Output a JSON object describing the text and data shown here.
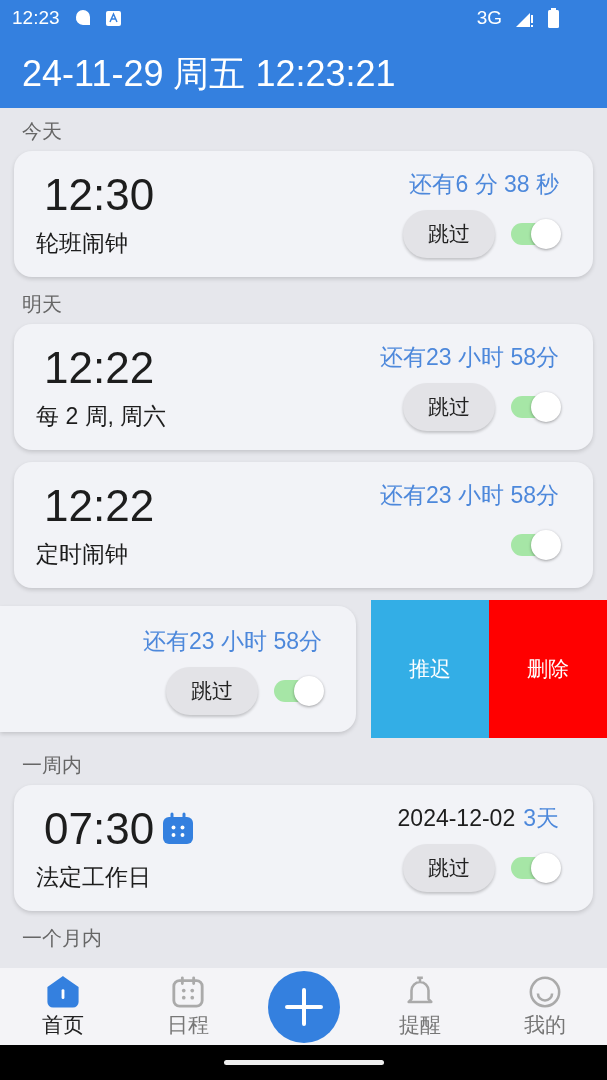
{
  "status_bar": {
    "time": "12:23",
    "network": "3G"
  },
  "header": {
    "title": "24-11-29 周五 12:23:21"
  },
  "sections": [
    {
      "title": "今天",
      "cards": [
        {
          "kind": "normal",
          "time": "12:30",
          "label": "轮班闹钟",
          "remain": "还有6 分 38 秒",
          "skip": "跳过",
          "on": true
        }
      ]
    },
    {
      "title": "明天",
      "cards": [
        {
          "kind": "normal",
          "time": "12:22",
          "label": "每 2 周, 周六",
          "remain": "还有23 小时 58分",
          "skip": "跳过",
          "on": true
        },
        {
          "kind": "normal",
          "time": "12:22",
          "label": "定时闹钟",
          "remain": "还有23 小时 58分",
          "on": true
        },
        {
          "kind": "swiped",
          "remain": "还有23 小时 58分",
          "skip": "跳过",
          "on": true,
          "actions": [
            {
              "label": "推迟",
              "color": "#33aee6"
            },
            {
              "label": "删除",
              "color": "#ff0000"
            }
          ]
        }
      ]
    },
    {
      "title": "一周内",
      "cards": [
        {
          "kind": "normal",
          "time": "07:30",
          "calendar": true,
          "label": "法定工作日",
          "date": "2024-12-02",
          "remain": "3天",
          "skip": "跳过",
          "on": true
        }
      ]
    },
    {
      "title": "一个月内"
    }
  ],
  "nav": [
    {
      "kind": "home",
      "label": "首页",
      "selected": true
    },
    {
      "kind": "schedule",
      "label": "日程",
      "selected": false
    },
    {
      "kind": "add"
    },
    {
      "kind": "reminder",
      "label": "提醒",
      "selected": false
    },
    {
      "kind": "profile",
      "label": "我的",
      "selected": false
    }
  ]
}
